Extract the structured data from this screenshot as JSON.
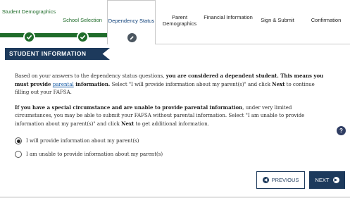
{
  "steps": [
    {
      "label": "Student Demographics",
      "state": "done",
      "icon": "check-icon"
    },
    {
      "label": "School Selection",
      "state": "done",
      "icon": "check-icon"
    },
    {
      "label": "Dependency Status",
      "state": "active",
      "icon": "pencil-icon"
    },
    {
      "label": "Parent Demographics",
      "state": "todo"
    },
    {
      "label": "Financial Information",
      "state": "todo"
    },
    {
      "label": "Sign & Submit",
      "state": "todo"
    },
    {
      "label": "Confirmation",
      "state": "todo"
    }
  ],
  "section": {
    "title": "STUDENT INFORMATION"
  },
  "para1": {
    "t1": "Based on your answers to the dependency status questions, ",
    "b1": "you are considered a dependent student. This means you must provide ",
    "link": "parental",
    "b2": " information.",
    "t2": " Select \"I will provide information about my parent(s)\" and click ",
    "b3": "Next",
    "t3": " to continue filling out your FAFSA."
  },
  "para2": {
    "b1": "If you have a special circumstance and are unable to provide parental information",
    "t1": ", under very limited circumstances, you may be able to submit your FAFSA without parental information. Select \"I am unable to provide information about my parent(s)\" and click ",
    "b2": "Next",
    "t2": " to get additional information."
  },
  "help": {
    "label": "?"
  },
  "options": [
    {
      "label": "I will provide information about my parent(s)",
      "checked": true
    },
    {
      "label": "I am unable to provide information about my parent(s)",
      "checked": false
    }
  ],
  "buttons": {
    "previous": "PREVIOUS",
    "next": "NEXT"
  },
  "colors": {
    "done": "#1f6c2a",
    "navy": "#1d3a5c",
    "link": "#1b5fa8"
  }
}
